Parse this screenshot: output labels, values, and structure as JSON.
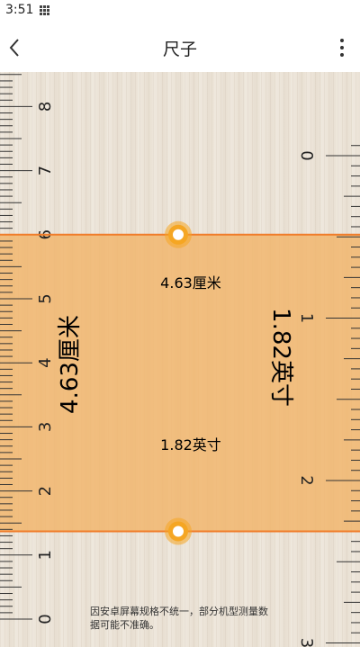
{
  "status": {
    "time": "3:51",
    "notification_icon": "grid-icon"
  },
  "appbar": {
    "title": "尺子",
    "back_icon": "chevron-left-icon",
    "menu_icon": "more-vertical-icon"
  },
  "left_ruler": {
    "unit": "cm",
    "labels": [
      "0",
      "1",
      "2",
      "3",
      "4",
      "5",
      "6",
      "7",
      "8"
    ]
  },
  "right_ruler": {
    "unit": "inch",
    "labels": [
      "0",
      "1",
      "2",
      "3"
    ]
  },
  "measurement": {
    "cm_center": "4.63厘米",
    "inch_center": "1.82英寸",
    "cm_vertical": "4.63厘米",
    "inch_vertical": "1.82英寸",
    "top_cm": 6.0,
    "bottom_cm": 1.37
  },
  "colors": {
    "highlight": "#f2b56a",
    "line": "#f07d2a",
    "handle": "#f5a623"
  },
  "disclaimer": "因安卓屏幕规格不统一，部分机型测量数据可能不准确。"
}
